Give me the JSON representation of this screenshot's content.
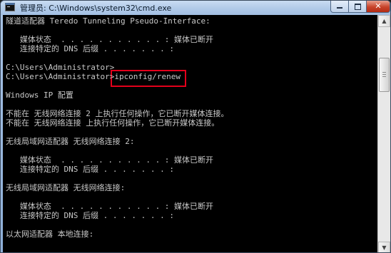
{
  "window": {
    "title": "管理员: C:\\Windows\\system32\\cmd.exe",
    "icon": "cmd-icon",
    "controls": {
      "minimize": "minimize-icon",
      "maximize": "maximize-icon",
      "close_label": "✕"
    }
  },
  "console": {
    "lines": [
      "隧道适配器 Teredo Tunneling Pseudo-Interface:",
      "",
      "   媒体状态  . . . . . . . . . . . : 媒体已断开",
      "   连接特定的 DNS 后缀 . . . . . . . :",
      "",
      "C:\\Users\\Administrator>",
      "C:\\Users\\Administrator>ipconfig/renew",
      "",
      "Windows IP 配置",
      "",
      "不能在 无线网络连接 2 上执行任何操作，它已断开媒体连接。",
      "不能在 无线网络连接 上执行任何操作，它已断开媒体连接。",
      "",
      "无线局域网适配器 无线网络连接 2:",
      "",
      "   媒体状态  . . . . . . . . . . . : 媒体已断开",
      "   连接特定的 DNS 后缀 . . . . . . . :",
      "",
      "无线局域网适配器 无线网络连接:",
      "",
      "   媒体状态  . . . . . . . . . . . : 媒体已断开",
      "   连接特定的 DNS 后缀 . . . . . . . :",
      "",
      "以太网适配器 本地连接:",
      ""
    ],
    "text_color": "#c8c8c8",
    "background": "#000000",
    "highlight_color": "#e3001b"
  },
  "scrollbar": {
    "up_icon": "scroll-up-icon",
    "down_icon": "scroll-down-icon",
    "up_glyph": "▲",
    "down_glyph": "▼"
  }
}
